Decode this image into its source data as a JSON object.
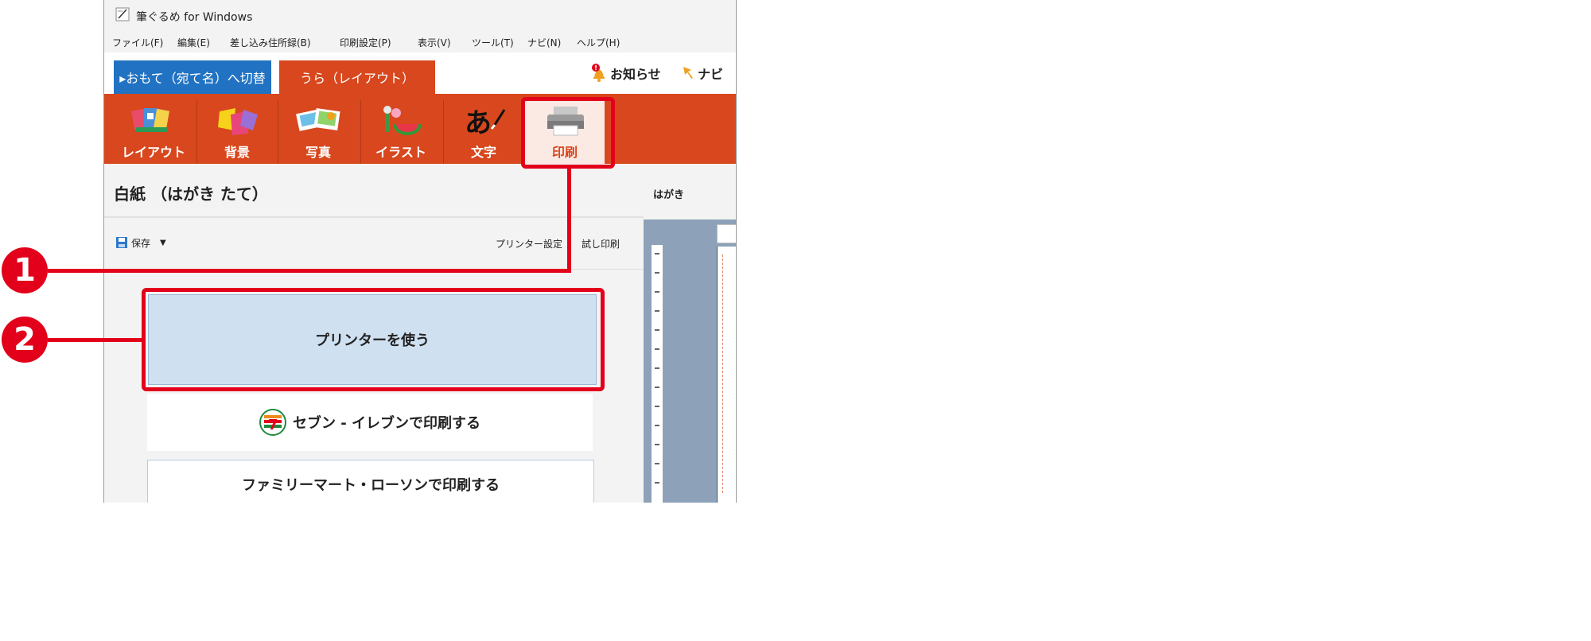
{
  "window": {
    "title": "筆ぐるめ for Windows"
  },
  "menu": [
    "ファイル(F)",
    "編集(E)",
    "差し込み住所録(B)",
    "印刷設定(P)",
    "表示(V)",
    "ツール(T)",
    "ナビ(N)",
    "ヘルプ(H)"
  ],
  "tabs": {
    "switch_front": "▸おもて（宛て名）へ切替",
    "back_label": "うら（レイアウト）"
  },
  "header_links": {
    "notice": "お知らせ",
    "navi": "ナビ"
  },
  "toolbar": [
    {
      "label": "レイアウト",
      "icon": "layout-icon"
    },
    {
      "label": "背景",
      "icon": "background-icon"
    },
    {
      "label": "写真",
      "icon": "photo-icon"
    },
    {
      "label": "イラスト",
      "icon": "illustration-icon"
    },
    {
      "label": "文字",
      "icon": "text-icon"
    },
    {
      "label": "印刷",
      "icon": "printer-icon"
    }
  ],
  "active_tool": "印刷",
  "panel": {
    "doc_title": "白紙 （はがき たて）",
    "save": "保存",
    "printer_settings": "プリンター設定",
    "test_print": "試し印刷",
    "options": {
      "use_printer": "プリンターを使う",
      "seven_eleven": "セブン - イレブンで印刷する",
      "familymart_lawson": "ファミリーマート・ローソンで印刷する"
    }
  },
  "preview": {
    "title": "はがき"
  },
  "callouts": [
    "1",
    "2"
  ],
  "colors": {
    "accent": "#d8471d",
    "front_tab": "#2172c2",
    "callout": "#e2001a",
    "primary_option": "#cfe0f0"
  }
}
